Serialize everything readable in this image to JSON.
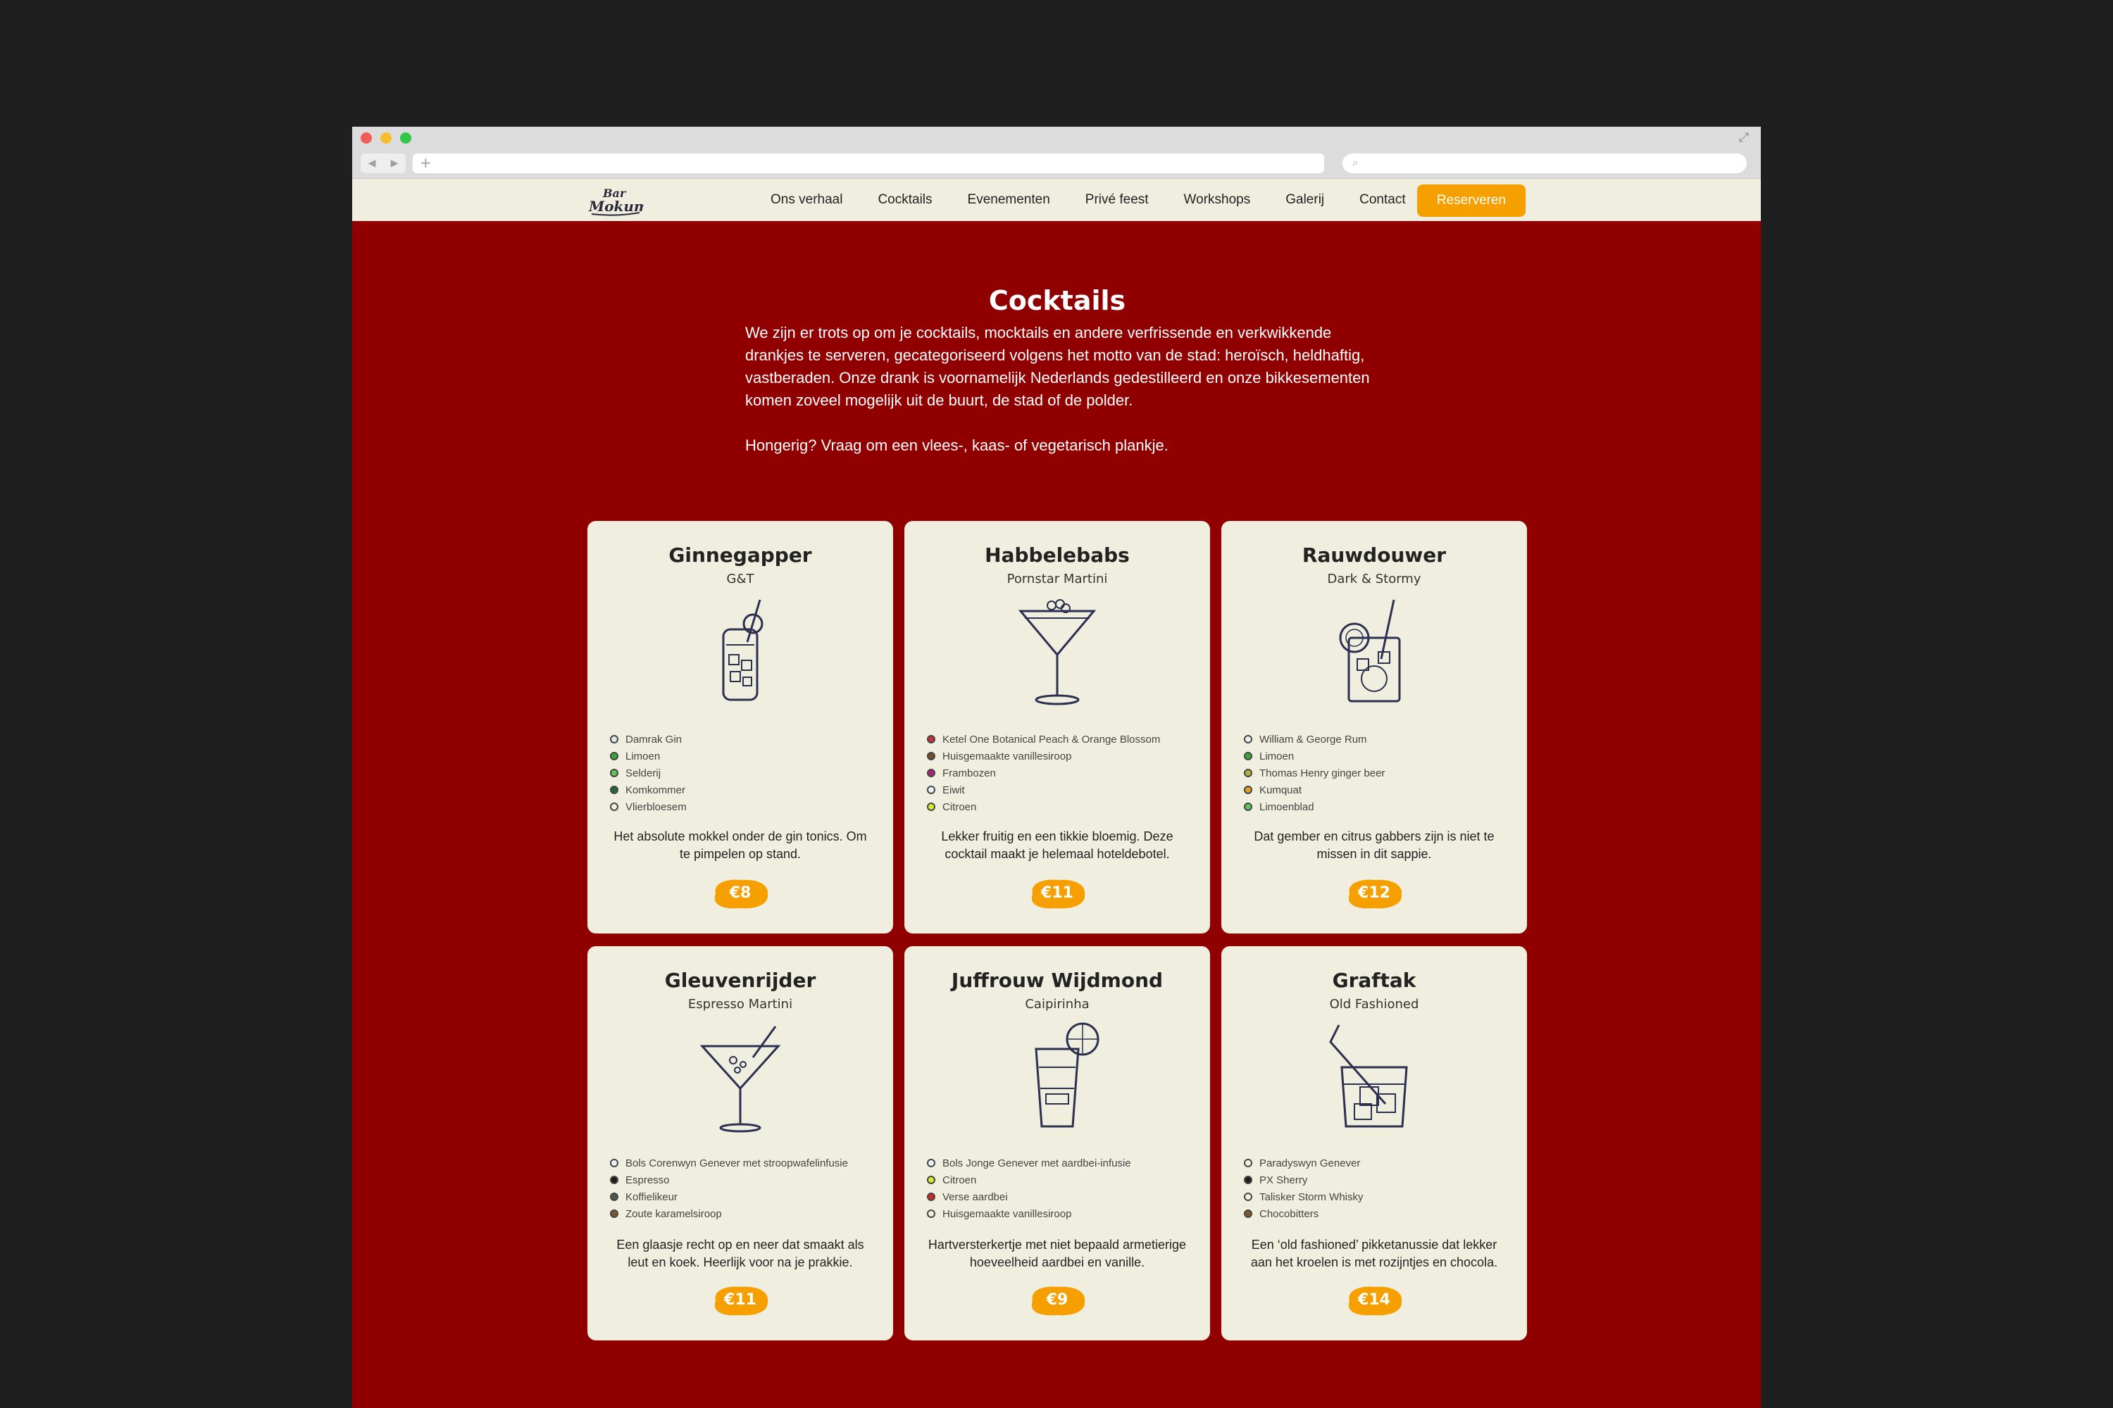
{
  "nav": {
    "links": [
      "Ons verhaal",
      "Cocktails",
      "Evenementen",
      "Privé feest",
      "Workshops",
      "Galerij",
      "Contact"
    ],
    "reserve": "Reserveren"
  },
  "page": {
    "title": "Cocktails",
    "intro": "We zijn er trots op om je cocktails, mocktails en andere verfrissende en verkwikkende drankjes te serveren, gecategoriseerd volgens het motto van de stad: heroïsch, heldhaftig, vastberaden. Onze drank is voornamelijk Nederlands gedestilleerd en onze bikkesementen komen zoveel mogelijk uit de buurt, de stad of de polder.",
    "intro2": "Hongerig? Vraag om een vlees-, kaas- of vegetarisch plankje."
  },
  "cards": [
    {
      "name": "Ginnegapper",
      "sub": "G&T",
      "icon": "highball-icon",
      "ingredients": [
        {
          "label": "Damrak Gin",
          "color": "#dfeaf0"
        },
        {
          "label": "Limoen",
          "color": "#3aa83a"
        },
        {
          "label": "Selderij",
          "color": "#5fc35f"
        },
        {
          "label": "Komkommer",
          "color": "#1e6b35"
        },
        {
          "label": "Vlierbloesem",
          "color": "#f2f0e0"
        }
      ],
      "desc": "Het absolute mokkel onder de gin tonics. Om te pimpelen op stand.",
      "price": "€8"
    },
    {
      "name": "Habbelebabs",
      "sub": "Pornstar Martini",
      "icon": "martini-icon",
      "ingredients": [
        {
          "label": "Ketel One Botanical Peach & Orange Blossom",
          "color": "#c8323c"
        },
        {
          "label": "Huisgemaakte vanillesiroop",
          "color": "#7a4a28"
        },
        {
          "label": "Frambozen",
          "color": "#b0207a"
        },
        {
          "label": "Eiwit",
          "color": "#eaf2f6"
        },
        {
          "label": "Citroen",
          "color": "#d8e830"
        }
      ],
      "desc": "Lekker fruitig en een tikkie bloemig. Deze cocktail maakt je helemaal hoteldebotel.",
      "price": "€11"
    },
    {
      "name": "Rauwdouwer",
      "sub": "Dark & Stormy",
      "icon": "rocks-lime-icon",
      "ingredients": [
        {
          "label": "William & George Rum",
          "color": "#eaf2f6"
        },
        {
          "label": "Limoen",
          "color": "#3aa83a"
        },
        {
          "label": "Thomas Henry ginger beer",
          "color": "#b8b040"
        },
        {
          "label": "Kumquat",
          "color": "#e0a020"
        },
        {
          "label": "Limoenblad",
          "color": "#5fc35f"
        }
      ],
      "desc": "Dat gember en citrus gabbers zijn is niet te missen in dit sappie.",
      "price": "€12"
    },
    {
      "name": "Gleuvenrijder",
      "sub": "Espresso Martini",
      "icon": "martini-straw-icon",
      "ingredients": [
        {
          "label": "Bols Corenwyn Genever met stroopwafelinfusie",
          "color": "#eaf2f6"
        },
        {
          "label": "Espresso",
          "color": "#1e1e1e"
        },
        {
          "label": "Koffielikeur",
          "color": "#4a5a4a"
        },
        {
          "label": "Zoute karamelsiroop",
          "color": "#7a5a2a"
        }
      ],
      "desc": "Een glaasje recht op en neer dat smaakt als leut en koek. Heerlijk voor na je prakkie.",
      "price": "€11"
    },
    {
      "name": "Juffrouw Wijdmond",
      "sub": "Caipirinha",
      "icon": "shot-glass-icon",
      "ingredients": [
        {
          "label": "Bols Jonge Genever met aardbei-infusie",
          "color": "#eaf2f6"
        },
        {
          "label": "Citroen",
          "color": "#d8e830"
        },
        {
          "label": "Verse aardbei",
          "color": "#d02828"
        },
        {
          "label": "Huisgemaakte vanillesiroop",
          "color": "#f2f0e0"
        }
      ],
      "desc": "Hartversterkertje met niet bepaald armetierige hoeveelheid aardbei en vanille.",
      "price": "€9"
    },
    {
      "name": "Graftak",
      "sub": "Old Fashioned",
      "icon": "old-fashioned-icon",
      "ingredients": [
        {
          "label": "Paradyswyn Genever",
          "color": "#f2f0e0"
        },
        {
          "label": "PX Sherry",
          "color": "#1e1e1e"
        },
        {
          "label": "Talisker Storm Whisky",
          "color": "#f2f0e0"
        },
        {
          "label": "Chocobitters",
          "color": "#7a5a2a"
        }
      ],
      "desc": "Een ‘old fashioned’ pikketanussie dat lekker aan het kroelen is met rozijntjes en chocola.",
      "price": "€14"
    }
  ],
  "colors": {
    "background": "#900000",
    "nav": "#f0eedf",
    "card": "#f0eedf",
    "accent": "#f5a000"
  }
}
